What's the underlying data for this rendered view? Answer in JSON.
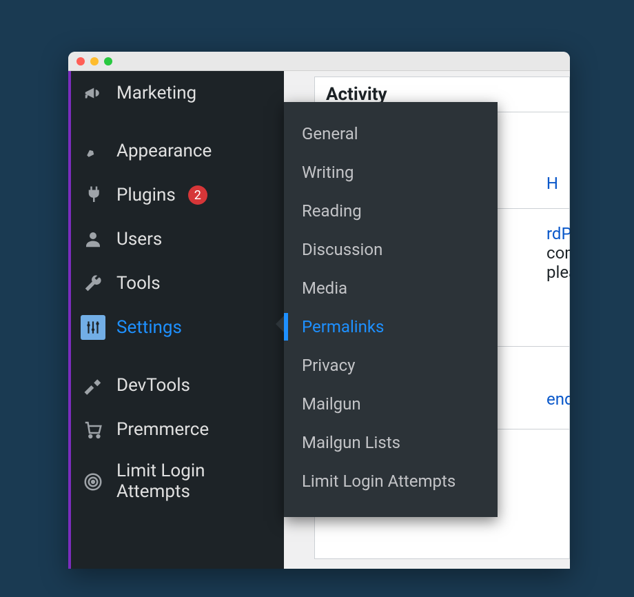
{
  "sidebar": {
    "items": [
      {
        "label": "Marketing",
        "icon": "megaphone-icon"
      },
      {
        "label": "Appearance",
        "icon": "brush-icon"
      },
      {
        "label": "Plugins",
        "icon": "plug-icon",
        "badge": "2"
      },
      {
        "label": "Users",
        "icon": "user-icon"
      },
      {
        "label": "Tools",
        "icon": "wrench-icon"
      },
      {
        "label": "Settings",
        "icon": "sliders-icon",
        "active": true
      },
      {
        "label": "DevTools",
        "icon": "hammer-icon"
      },
      {
        "label": "Premmerce",
        "icon": "cart-icon"
      },
      {
        "label": "Limit Login Attempts",
        "icon": "fingerprint-icon"
      }
    ]
  },
  "flyout": {
    "items": [
      "General",
      "Writing",
      "Reading",
      "Discussion",
      "Media",
      "Permalinks",
      "Privacy",
      "Mailgun",
      "Mailgun Lists",
      "Limit Login Attempts"
    ],
    "activeIndex": 5
  },
  "main": {
    "panel_title": "Activity",
    "link1": "H",
    "link2": "rdPres",
    "text2a": "comm",
    "text2b": "pleas",
    "link3": "ending"
  }
}
